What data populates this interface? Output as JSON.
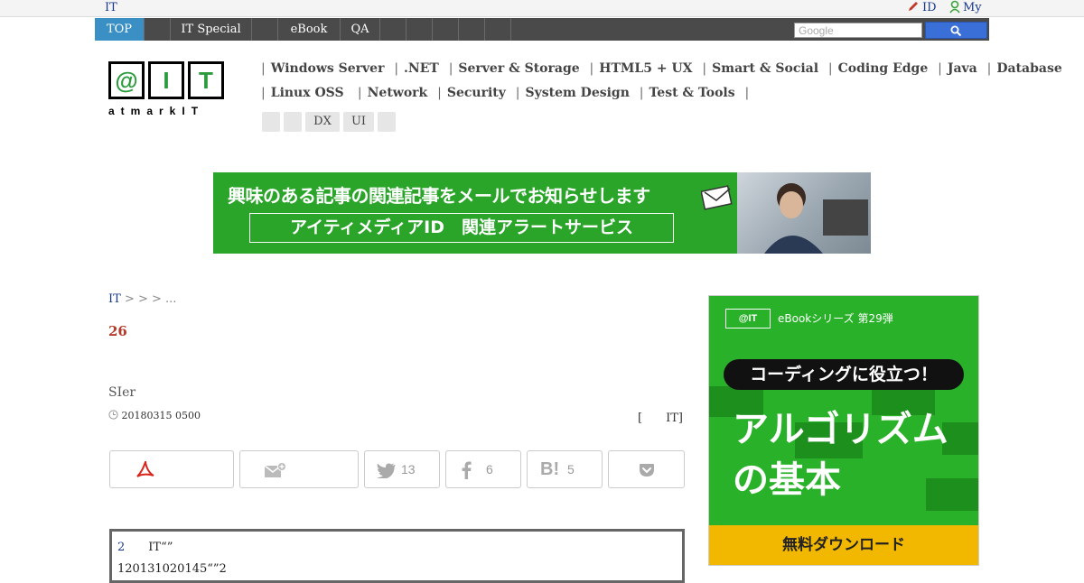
{
  "topbar": {
    "site_label": "IT",
    "id_label": "ID",
    "my_label": "My"
  },
  "nav": {
    "items": [
      "TOP",
      "",
      "IT Special",
      "",
      "eBook",
      "QA",
      "",
      "",
      "",
      "",
      ""
    ],
    "search_placeholder": "Google"
  },
  "logo": {
    "letters": [
      "@",
      "I",
      "T"
    ],
    "subtitle": "atmarkIT"
  },
  "categories": {
    "row1": [
      "Windows Server",
      ".NET",
      "Server & Storage",
      "HTML5 + UX",
      "Smart & Social",
      "Coding Edge",
      "Java",
      "Database"
    ],
    "row2": [
      "Linux  OSS",
      "Network",
      "Security",
      "System Design",
      "Test & Tools"
    ],
    "tags": [
      "",
      "",
      "DX",
      "UI",
      ""
    ]
  },
  "banner": {
    "headline": "興味のある記事の関連記事をメールでお知らせします",
    "cta": "アイティメディアID　関連アラートサービス"
  },
  "article": {
    "breadcrumb_home": "IT",
    "breadcrumb_rest": " >   >   > ...",
    "title": "26",
    "subtitle": "SIer",
    "date": "20180315 0500",
    "author": "[　　IT]",
    "summary_line1_num": "2",
    "summary_line1_text": "　　IT“”",
    "summary_line2": "120131020145“”2"
  },
  "share": {
    "twitter_count": "13",
    "facebook_count": "6",
    "hatena_count": "5"
  },
  "side_ad": {
    "logo": "@IT",
    "series": "eBookシリーズ 第29弾",
    "pill": "コーディングに役立つ！",
    "title_line1": "アルゴリズム",
    "title_line2": "の基本",
    "download": "無料ダウンロード"
  },
  "colors": {
    "nav_bg": "#4a4a4a",
    "nav_active": "#3a8fc4",
    "title_red": "#b53a2a",
    "banner_green": "#2aa52a",
    "ad_yellow": "#f2b800"
  }
}
